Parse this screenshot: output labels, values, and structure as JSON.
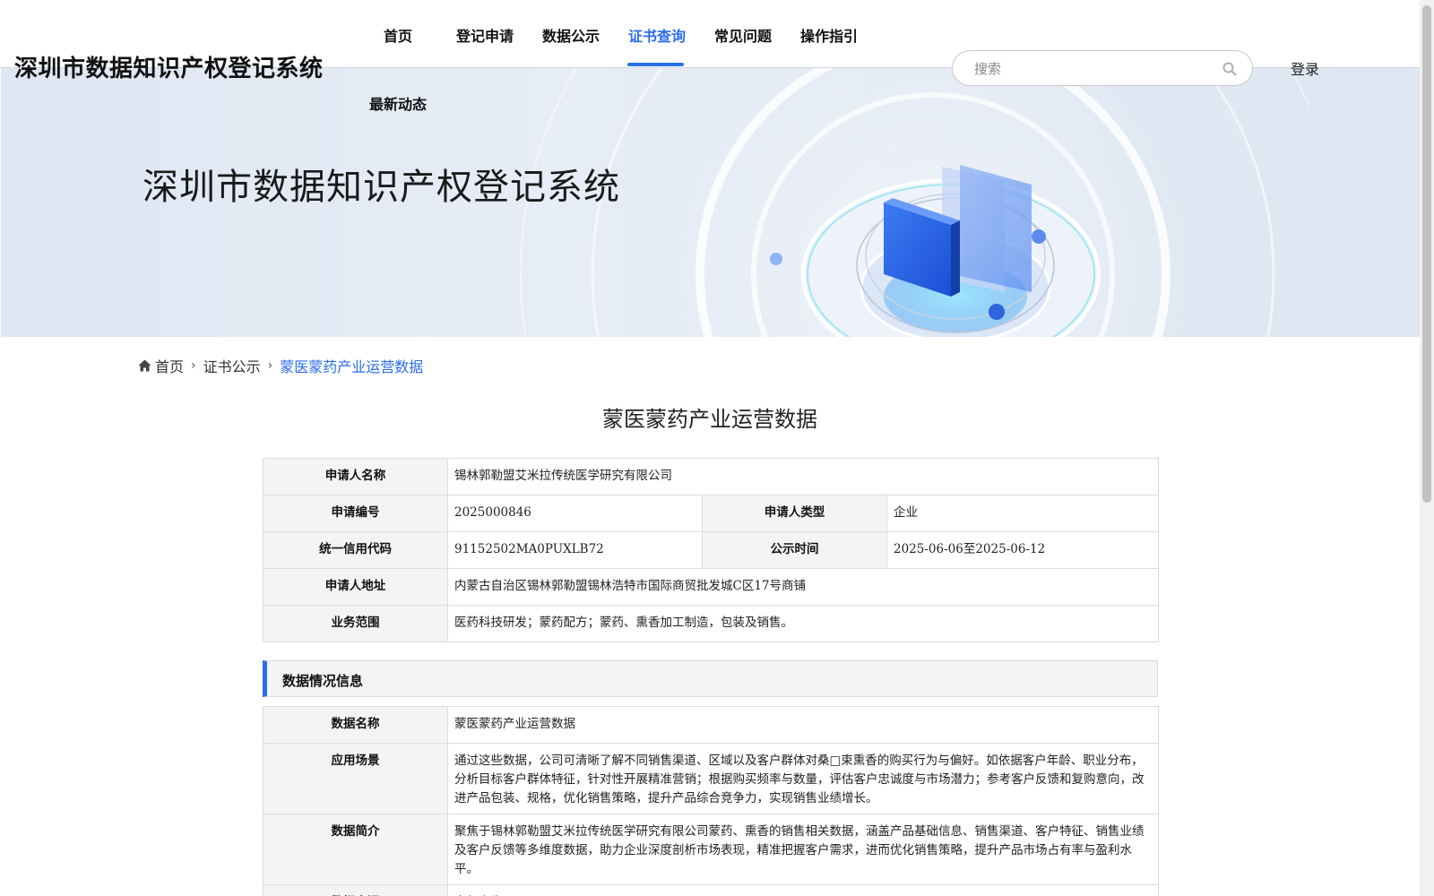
{
  "header": {
    "site_title": "深圳市数据知识产权登记系统",
    "nav": [
      {
        "label": "首页",
        "active": false
      },
      {
        "label": "登记申请",
        "active": false
      },
      {
        "label": "数据公示",
        "active": false
      },
      {
        "label": "证书查询",
        "active": true
      },
      {
        "label": "常见问题",
        "active": false
      },
      {
        "label": "操作指引",
        "active": false
      },
      {
        "label": "最新动态",
        "active": false
      }
    ],
    "search_placeholder": "搜索",
    "login_label": "登录"
  },
  "banner": {
    "title": "深圳市数据知识产权登记系统"
  },
  "breadcrumb": {
    "home": "首页",
    "level2": "证书公示",
    "current": "蒙医蒙药产业运营数据"
  },
  "page_title": "蒙医蒙药产业运营数据",
  "applicant": {
    "name_label": "申请人名称",
    "name_value": "锡林郭勒盟艾米拉传统医学研究有限公司",
    "number_label": "申请编号",
    "number_value": "2025000846",
    "type_label": "申请人类型",
    "type_value": "企业",
    "credit_label": "统一信用代码",
    "credit_value": "91152502MA0PUXLB72",
    "publicity_label": "公示时间",
    "publicity_value": "2025-06-06至2025-06-12",
    "address_label": "申请人地址",
    "address_value": "内蒙古自治区锡林郭勒盟锡林浩特市国际商贸批发城C区17号商铺",
    "scope_label": "业务范围",
    "scope_value": "医药科技研发；蒙药配方；蒙药、熏香加工制造，包装及销售。"
  },
  "section": {
    "title": "数据情况信息"
  },
  "data_info": {
    "name_label": "数据名称",
    "name_value": "蒙医蒙药产业运营数据",
    "scene_label": "应用场景",
    "scene_value": "通过这些数据，公司可清晰了解不同销售渠道、区域以及客户群体对桑□束熏香的购买行为与偏好。如依据客户年龄、职业分布，分析目标客户群体特征，针对性开展精准营销；根据购买频率与数量，评估客户忠诚度与市场潜力；参考客户反馈和复购意向，改进产品包装、规格，优化销售策略，提升产品综合竞争力，实现销售业绩增长。",
    "intro_label": "数据简介",
    "intro_value": "聚焦于锡林郭勒盟艾米拉传统医学研究有限公司蒙药、熏香的销售相关数据，涵盖产品基础信息、销售渠道、客户特征、销售业绩及客户反馈等多维度数据，助力企业深度剖析市场表现，精准把握客户需求，进而优化销售策略，提升产品市场占有率与盈利水平。",
    "source_label": "数据来源",
    "source_value": "自行产生"
  },
  "colors": {
    "accent": "#2a6de8",
    "label_bg": "#f4f4f4",
    "border": "#dcdcdc"
  }
}
